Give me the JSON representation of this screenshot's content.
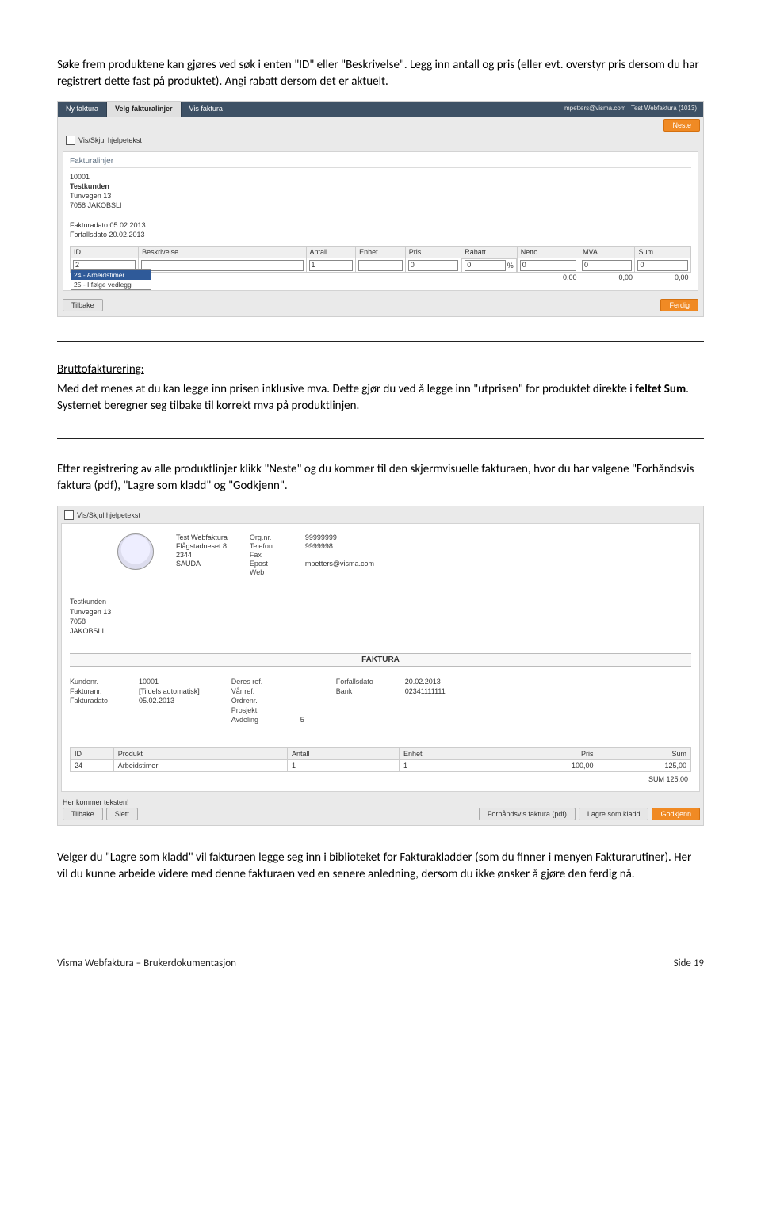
{
  "para1": "Søke frem produktene kan gjøres ved søk i enten \"ID\" eller \"Beskrivelse\". Legg inn antall og pris (eller evt. overstyr pris dersom du har registrert dette fast på produktet). Angi rabatt dersom det er aktuelt.",
  "brutto_title": "Bruttofakturering:",
  "brutto_text_a": "Med det menes at du kan legge inn prisen inklusive mva. Dette gjør du ved å legge inn \"utprisen\" for produktet direkte i ",
  "brutto_text_b": "feltet Sum",
  "brutto_text_c": ". Systemet beregner seg tilbake til korrekt mva på produktlinjen.",
  "para2": "Etter registrering av alle produktlinjer klikk \"Neste\" og du kommer til den skjermvisuelle fakturaen, hvor du har valgene \"Forhåndsvis faktura (pdf), \"Lagre som kladd\" og \"Godkjenn\".",
  "para3": "Velger du \"Lagre som kladd\" vil fakturaen legge seg inn i biblioteket for Fakturakladder (som du finner i menyen Fakturarutiner).  Her vil du kunne arbeide videre med denne fakturaen ved en senere anledning, dersom du ikke ønsker å gjøre den ferdig nå.",
  "shot1": {
    "tabs": [
      "Ny faktura",
      "Velg fakturalinjer",
      "Vis faktura"
    ],
    "active_tab": "Velg fakturalinjer",
    "right_user": "mpetters@visma.com",
    "right_company": "Test Webfaktura (1013)",
    "neste": "Neste",
    "helptext": "Vis/Skjul hjelpetekst",
    "panel_title": "Fakturalinjer",
    "cust_no": "10001",
    "cust_name": "Testkunden",
    "cust_addr": "Tunvegen 13",
    "cust_city": "7058 JAKOBSLI",
    "inv_date": "Fakturadato 05.02.2013",
    "due_date": "Forfallsdato 20.02.2013",
    "cols": [
      "ID",
      "Beskrivelse",
      "Antall",
      "Enhet",
      "Pris",
      "Rabatt",
      "Netto",
      "MVA",
      "Sum"
    ],
    "row": {
      "id": "2",
      "besk": "",
      "antall": "1",
      "enhet": "",
      "pris": "0",
      "rabatt": "0",
      "rabatt_unit": "%",
      "netto": "0",
      "mva": "0",
      "sum": "0"
    },
    "tot_netto": "0,00",
    "tot_mva": "0,00",
    "tot_sum": "0,00",
    "dd_sel": "24 - Arbeidstimer",
    "dd_other": "25 - I følge vedlegg",
    "tilbake": "Tilbake",
    "ferdig": "Ferdig"
  },
  "shot2": {
    "helptext": "Vis/Skjul hjelpetekst",
    "company_name": "Test Webfaktura",
    "company_addr": "Flågstadneset 8",
    "company_postno": "2344",
    "company_city": "SAUDA",
    "labels": {
      "orgnr": "Org.nr.",
      "tlf": "Telefon",
      "fax": "Fax",
      "epost": "Epost",
      "web": "Web"
    },
    "orgnr": "99999999",
    "tlf": "9999998",
    "epost": "mpetters@visma.com",
    "cust_name": "Testkunden",
    "cust_addr": "Tunvegen 13",
    "cust_postno": "7058",
    "cust_city": "JAKOBSLI",
    "faktura_heading": "FAKTURA",
    "meta_labels": {
      "kundenr": "Kundenr.",
      "fakturanr": "Fakturanr.",
      "fakturadato": "Fakturadato",
      "deresref": "Deres ref.",
      "vaarref": "Vår ref.",
      "ordrenr": "Ordrenr.",
      "prosjekt": "Prosjekt",
      "avdeling": "Avdeling",
      "forfall": "Forfallsdato",
      "bank": "Bank"
    },
    "kundenr": "10001",
    "fakturanr": "[Tildels automatisk]",
    "fakturadato": "05.02.2013",
    "avdeling": "5",
    "forfall": "20.02.2013",
    "bank": "02341111111",
    "pcols": [
      "ID",
      "Produkt",
      "Antall",
      "Enhet",
      "Pris",
      "Sum"
    ],
    "prow": {
      "id": "24",
      "prod": "Arbeidstimer",
      "antall": "1",
      "enhet": "1",
      "pris": "100,00",
      "sum": "125,00"
    },
    "sum_label": "SUM 125,00",
    "footer_text": "Her kommer teksten!",
    "tilbake": "Tilbake",
    "slett": "Slett",
    "forhandsvis": "Forhåndsvis faktura (pdf)",
    "lagre": "Lagre som kladd",
    "godkjenn": "Godkjenn"
  },
  "footer_left": "Visma Webfaktura – Brukerdokumentasjon",
  "footer_right": "Side 19"
}
